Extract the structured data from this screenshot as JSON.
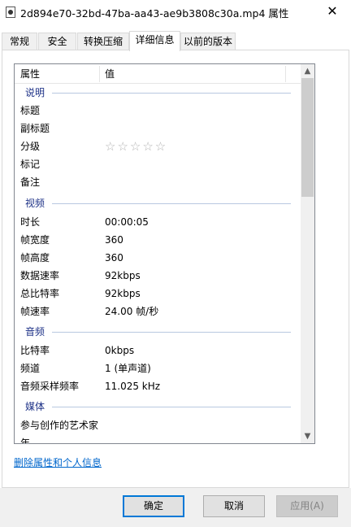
{
  "window": {
    "title": "2d894e70-32bd-47ba-aa43-ae9b3808c30a.mp4 属性",
    "close_glyph": "✕"
  },
  "tabs": [
    "常规",
    "安全",
    "转换压缩",
    "详细信息",
    "以前的版本"
  ],
  "list": {
    "header_property": "属性",
    "header_value": "值",
    "groups": {
      "description": "说明",
      "video": "视频",
      "audio": "音频",
      "media": "媒体"
    },
    "description_rows": [
      {
        "key": "标题",
        "value": ""
      },
      {
        "key": "副标题",
        "value": ""
      },
      {
        "key": "分级",
        "value": "☆☆☆☆☆"
      },
      {
        "key": "标记",
        "value": ""
      },
      {
        "key": "备注",
        "value": ""
      }
    ],
    "video_rows": [
      {
        "key": "时长",
        "value": "00:00:05"
      },
      {
        "key": "帧宽度",
        "value": "360"
      },
      {
        "key": "帧高度",
        "value": "360"
      },
      {
        "key": "数据速率",
        "value": "92kbps"
      },
      {
        "key": "总比特率",
        "value": "92kbps"
      },
      {
        "key": "帧速率",
        "value": "24.00 帧/秒"
      }
    ],
    "audio_rows": [
      {
        "key": "比特率",
        "value": "0kbps"
      },
      {
        "key": "频道",
        "value": "1 (单声道)"
      },
      {
        "key": "音频采样频率",
        "value": "11.025 kHz"
      }
    ],
    "media_rows": [
      {
        "key": "参与创作的艺术家",
        "value": ""
      },
      {
        "key": "年",
        "value": ""
      }
    ],
    "rating_stars": 0,
    "scroll_up_glyph": "▲",
    "scroll_down_glyph": "▼"
  },
  "remove_link": "删除属性和个人信息",
  "buttons": {
    "ok": "确定",
    "cancel": "取消",
    "apply": "应用(A)"
  },
  "colors": {
    "group_header": "#1e3287",
    "link": "#0066cc",
    "default_button_border": "#0078d7"
  }
}
